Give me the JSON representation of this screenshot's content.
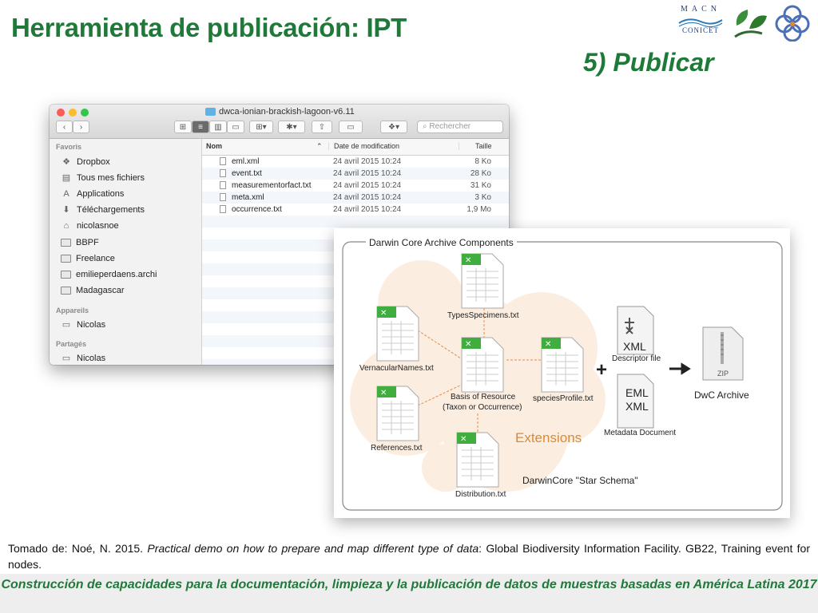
{
  "slide": {
    "title": "Herramienta de publicación: IPT",
    "subtitle": "5) Publicar",
    "logo_text_top": "MACN",
    "logo_text_bottom": "CONICET",
    "source_prefix": "Tomado de: Noé, N. 2015. ",
    "source_italic": "Practical demo on how to prepare and map different type of data",
    "source_suffix": ": Global Biodiversity Information Facility. GB22, Training event  for nodes.",
    "footer": "Construcción de capacidades para la documentación, limpieza y la publicación de datos de muestras basadas en América Latina 2017",
    "colors": {
      "accent": "#1f7a3a",
      "footer_bg": "#eeeeee"
    }
  },
  "finder": {
    "window_title": "dwca-ionian-brackish-lagoon-v6.11",
    "search_placeholder": "Rechercher",
    "sidebar": {
      "favorites_label": "Favoris",
      "favorites": [
        {
          "label": "Dropbox",
          "icon": "dropbox-icon"
        },
        {
          "label": "Tous mes fichiers",
          "icon": "all-files-icon"
        },
        {
          "label": "Applications",
          "icon": "applications-icon"
        },
        {
          "label": "Téléchargements",
          "icon": "downloads-icon"
        },
        {
          "label": "nicolasnoe",
          "icon": "home-icon"
        },
        {
          "label": "BBPF",
          "icon": "folder-icon"
        },
        {
          "label": "Freelance",
          "icon": "folder-icon"
        },
        {
          "label": "emilieperdaens.archi",
          "icon": "folder-icon"
        },
        {
          "label": "Madagascar",
          "icon": "folder-icon"
        }
      ],
      "devices_label": "Appareils",
      "devices": [
        {
          "label": "Nicolas",
          "icon": "computer-icon"
        }
      ],
      "shared_label": "Partagés",
      "shared": [
        {
          "label": "Nicolas",
          "icon": "computer-icon"
        }
      ]
    },
    "columns": {
      "name": "Nom",
      "date": "Date de modification",
      "size": "Taille"
    },
    "files": [
      {
        "name": "eml.xml",
        "date": "24 avril 2015 10:24",
        "size": "8 Ko"
      },
      {
        "name": "event.txt",
        "date": "24 avril 2015 10:24",
        "size": "28 Ko"
      },
      {
        "name": "measurementorfact.txt",
        "date": "24 avril 2015 10:24",
        "size": "31 Ko"
      },
      {
        "name": "meta.xml",
        "date": "24 avril 2015 10:24",
        "size": "3 Ko"
      },
      {
        "name": "occurrence.txt",
        "date": "24 avril 2015 10:24",
        "size": "1,9 Mo"
      }
    ]
  },
  "diagram": {
    "title": "Darwin Core Archive Components",
    "types_specimens": "TypesSpecimens.txt",
    "vernacular": "VernacularNames.txt",
    "core_line1": "Basis of Resource",
    "core_line2": "(Taxon or Occurrence)",
    "species_profile": "speciesProfile.txt",
    "references": "References.txt",
    "distribution": "Distribution.txt",
    "extensions": "Extensions",
    "star_schema": "DarwinCore \"Star Schema\"",
    "plus": "+",
    "xml_badge": "XML",
    "descriptor": "Descriptor file",
    "eml_badge": "EML",
    "xml_badge2": "XML",
    "metadata": "Metadata Document",
    "zip_badge": "ZIP",
    "archive": "DwC Archive"
  }
}
